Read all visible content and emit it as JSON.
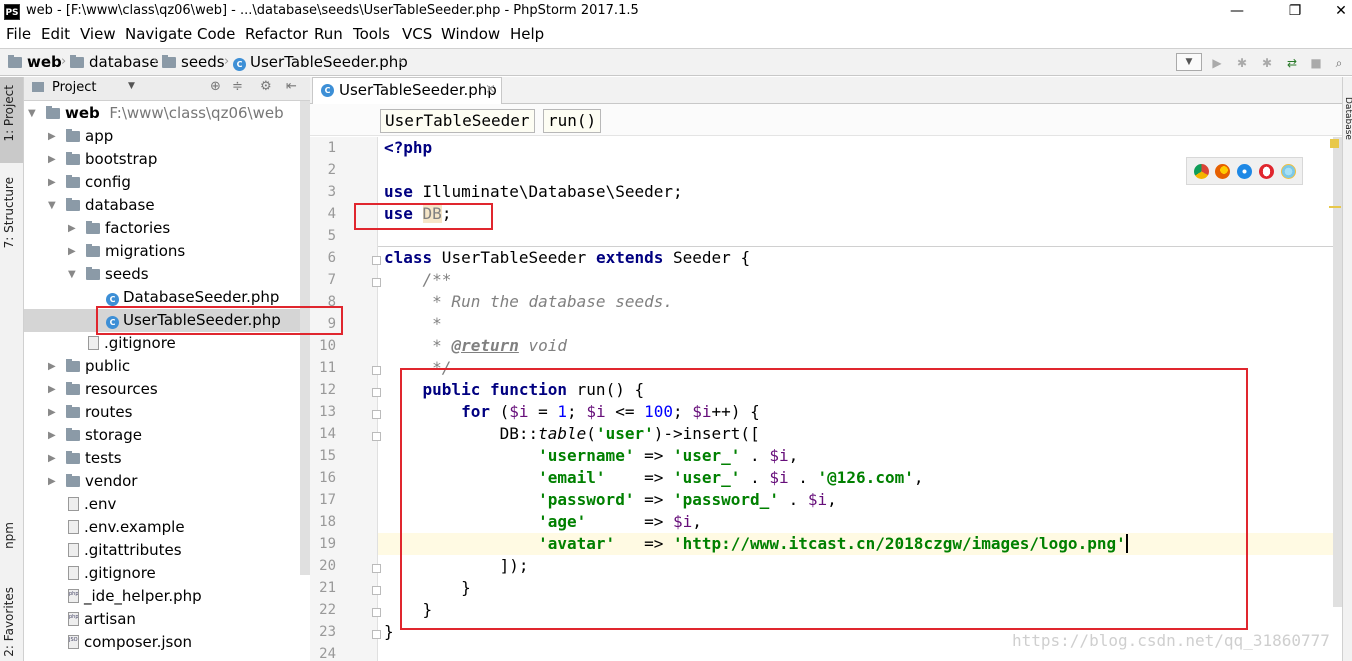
{
  "window": {
    "title": "web - [F:\\www\\class\\qz06\\web] - ...\\database\\seeds\\UserTableSeeder.php - PhpStorm 2017.1.5",
    "logo_text": "PS",
    "minimize": "—",
    "restore": "❐",
    "close": "✕"
  },
  "menu": [
    "File",
    "Edit",
    "View",
    "Navigate",
    "Code",
    "Refactor",
    "Run",
    "Tools",
    "VCS",
    "Window",
    "Help"
  ],
  "navbar": {
    "crumbs": [
      "web",
      "database",
      "seeds",
      "UserTableSeeder.php"
    ]
  },
  "left_strip": {
    "project": "1: Project",
    "structure": "7: Structure",
    "npm": "npm",
    "favorites": "2: Favorites"
  },
  "right_strip": {
    "database": "Database"
  },
  "project_panel": {
    "title": "Project",
    "root_name": "web",
    "root_path": "F:\\www\\class\\qz06\\web",
    "items": [
      "app",
      "bootstrap",
      "config",
      "database",
      "factories",
      "migrations",
      "seeds",
      "DatabaseSeeder.php",
      "UserTableSeeder.php",
      ".gitignore",
      "public",
      "resources",
      "routes",
      "storage",
      "tests",
      "vendor",
      ".env",
      ".env.example",
      ".gitattributes",
      ".gitignore",
      "_ide_helper.php",
      "artisan",
      "composer.json"
    ],
    "file_badges": {
      "php": "php",
      "json": "JSON"
    }
  },
  "editor": {
    "tab": "UserTableSeeder.php",
    "tab_close": "×",
    "breadcrumb": [
      "UserTableSeeder",
      "run()"
    ],
    "line_numbers": [
      "1",
      "2",
      "3",
      "4",
      "5",
      "6",
      "7",
      "8",
      "9",
      "10",
      "11",
      "12",
      "13",
      "14",
      "15",
      "16",
      "17",
      "18",
      "19",
      "20",
      "21",
      "22",
      "23",
      "24"
    ],
    "code": {
      "l1": "<?php",
      "l3_kw": "use",
      "l3_rest": " Illuminate\\Database\\Seeder;",
      "l4_kw": "use",
      "l4_db": "DB",
      "l4_end": ";",
      "l6_kw1": "class",
      "l6_name": " UserTableSeeder ",
      "l6_kw2": "extends",
      "l6_rest": " Seeder {",
      "l7": "    /**",
      "l8": "     * Run the database seeds.",
      "l9": "     *",
      "l10_a": "     * ",
      "l10_tag": "@return",
      "l10_b": " void",
      "l11": "     */",
      "l12_kw1": "public",
      "l12_kw2": "function",
      "l12_rest": " run() {",
      "l13_kw": "for",
      "l13_a": " (",
      "l13_v1": "$i",
      "l13_b": " = ",
      "l13_n1": "1",
      "l13_c": "; ",
      "l13_v2": "$i",
      "l13_d": " <= ",
      "l13_n2": "100",
      "l13_e": "; ",
      "l13_v3": "$i",
      "l13_f": "++) {",
      "l14_a": "DB::",
      "l14_m": "table",
      "l14_b": "(",
      "l14_s": "'user'",
      "l14_c": ")->insert([",
      "l15_k": "'username'",
      "l15_a": " => ",
      "l15_s": "'user_'",
      "l15_b": " . ",
      "l15_v": "$i",
      "l15_c": ",",
      "l16_k": "'email'",
      "l16_a": "    => ",
      "l16_s": "'user_'",
      "l16_b": " . ",
      "l16_v": "$i",
      "l16_c": " . ",
      "l16_s2": "'@126.com'",
      "l16_d": ",",
      "l17_k": "'password'",
      "l17_a": " => ",
      "l17_s": "'password_'",
      "l17_b": " . ",
      "l17_v": "$i",
      "l17_c": ",",
      "l18_k": "'age'",
      "l18_a": "      => ",
      "l18_v": "$i",
      "l18_c": ",",
      "l19_k": "'avatar'",
      "l19_a": "   => ",
      "l19_s": "'http://www.itcast.cn/2018czgw/images/logo.png'",
      "l20": "]);",
      "l21": "}",
      "l22": "}",
      "l23": "}"
    }
  },
  "watermark": "https://blog.csdn.net/qq_31860777"
}
